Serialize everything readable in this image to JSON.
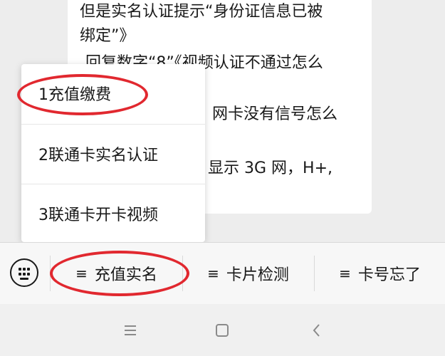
{
  "chat": {
    "lines": [
      "但是实名认证提示“身份证信息已被",
      "绑定”》",
      "回复数字“8”《视频认证不通过怎么",
      "网卡没有信号怎么",
      "显示 3G 网，H+,"
    ]
  },
  "popup": {
    "items": [
      {
        "label": "1充值缴费"
      },
      {
        "label": "2联通卡实名认证"
      },
      {
        "label": "3联通卡开卡视频"
      }
    ]
  },
  "menu_bar": {
    "keyboard_icon": "keyboard-icon",
    "items": [
      {
        "icon": "≡",
        "label": "充值实名"
      },
      {
        "icon": "≡",
        "label": "卡片检测"
      },
      {
        "icon": "≡",
        "label": "卡号忘了"
      }
    ]
  },
  "nav_bar": {
    "icons": [
      "menu-icon",
      "home-square-icon",
      "back-icon"
    ]
  },
  "colors": {
    "highlight": "#e1282f",
    "background": "#ededed",
    "bubble": "#ffffff"
  }
}
